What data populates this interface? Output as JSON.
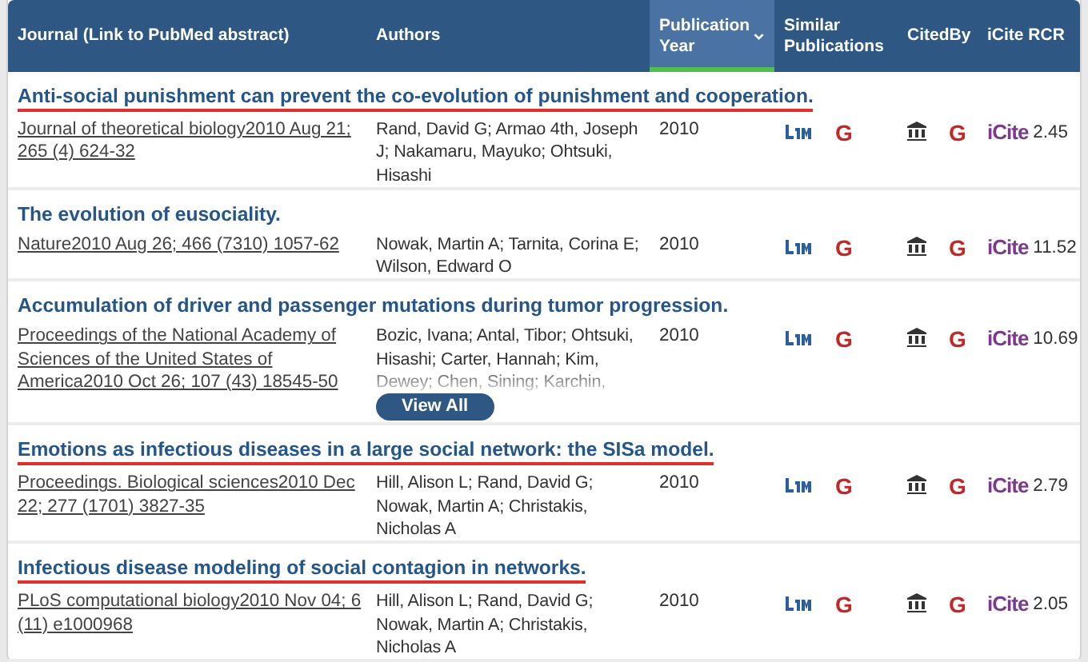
{
  "header": {
    "columns": [
      {
        "label": "Journal (Link to PubMed abstract)",
        "sorted": false
      },
      {
        "label": "Authors",
        "sorted": false
      },
      {
        "label": "Publication Year",
        "sorted": true
      },
      {
        "label": "Similar Publications",
        "sorted": false
      },
      {
        "label": "CitedBy",
        "sorted": false
      },
      {
        "label": "iCite RCR",
        "sorted": false
      }
    ]
  },
  "rows": [
    {
      "title": "Anti-social punishment can prevent the co-evolution of punishment and cooperation.",
      "highlighted": true,
      "journal": "Journal of theoretical biology2010 Aug 21; 265 (4) 624-32",
      "authors": "Rand, David G; Armao 4th, Joseph J; Nakamaru, Mayuko; Ohtsuki, Hisashi",
      "authors_collapsed": false,
      "year": "2010",
      "similar_google": "G",
      "cited_google": "G",
      "icite_logo": "iCite",
      "rcr": "2.45"
    },
    {
      "title": "The evolution of eusociality.",
      "highlighted": false,
      "journal": "Nature2010 Aug 26; 466 (7310) 1057-62",
      "authors": "Nowak, Martin A; Tarnita, Corina E; Wilson, Edward O",
      "authors_collapsed": false,
      "year": "2010",
      "similar_google": "G",
      "cited_google": "G",
      "icite_logo": "iCite",
      "rcr": "11.52"
    },
    {
      "title": "Accumulation of driver and passenger mutations during tumor progression.",
      "highlighted": false,
      "journal": "Proceedings of the National Academy of Sciences of the United States of America2010 Oct 26; 107 (43) 18545-50",
      "authors": "Bozic, Ivana; Antal, Tibor; Ohtsuki, Hisashi; Carter, Hannah; Kim, Dewey; Chen, Sining; Karchin,",
      "authors_collapsed": true,
      "view_all": "View All",
      "year": "2010",
      "similar_google": "G",
      "cited_google": "G",
      "icite_logo": "iCite",
      "rcr": "10.69"
    },
    {
      "title": "Emotions as infectious diseases in a large social network: the SISa model.",
      "highlighted": true,
      "journal": "Proceedings. Biological sciences2010 Dec 22; 277 (1701) 3827-35",
      "authors": "Hill, Alison L; Rand, David G; Nowak, Martin A; Christakis, Nicholas A",
      "authors_collapsed": false,
      "year": "2010",
      "similar_google": "G",
      "cited_google": "G",
      "icite_logo": "iCite",
      "rcr": "2.79"
    },
    {
      "title": "Infectious disease modeling of social contagion in networks.",
      "highlighted": true,
      "journal": "PLoS computational biology2010 Nov 04; 6 (11) e1000968",
      "authors": "Hill, Alison L; Rand, David G; Nowak, Martin A; Christakis, Nicholas A",
      "authors_collapsed": false,
      "year": "2010",
      "similar_google": "G",
      "cited_google": "G",
      "icite_logo": "iCite",
      "rcr": "2.05"
    }
  ]
}
